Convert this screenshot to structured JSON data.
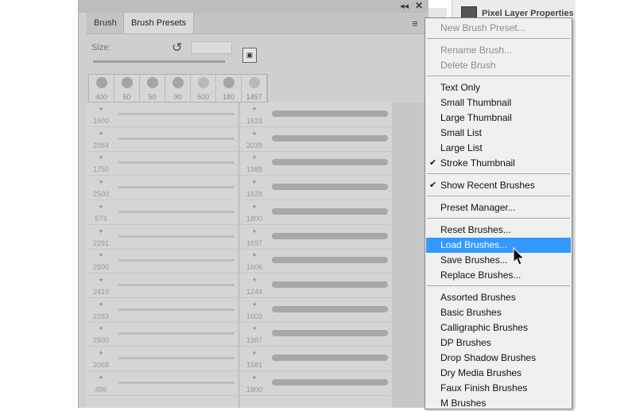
{
  "tabs": {
    "brush": "Brush",
    "presets": "Brush Presets"
  },
  "size_label": "Size:",
  "props_title": "Pixel Layer Properties",
  "recent_sizes": [
    "400",
    "50",
    "50",
    "90",
    "500",
    "180",
    "1457"
  ],
  "brushes_left": [
    "1600",
    "2084",
    "1750",
    "2500",
    "674",
    "2291",
    "2500",
    "2410",
    "2283",
    "2500",
    "2068",
    "496"
  ],
  "brushes_right": [
    "1623",
    "2039",
    "1988",
    "1628",
    "1800",
    "1697",
    "1606",
    "1244",
    "1603",
    "1987",
    "1581",
    "1800"
  ],
  "menu": {
    "new_preset": "New Brush Preset...",
    "rename": "Rename Brush...",
    "delete": "Delete Brush",
    "text_only": "Text Only",
    "small_thumb": "Small Thumbnail",
    "large_thumb": "Large Thumbnail",
    "small_list": "Small List",
    "large_list": "Large List",
    "stroke_thumb": "Stroke Thumbnail",
    "show_recent": "Show Recent Brushes",
    "preset_manager": "Preset Manager...",
    "reset": "Reset Brushes...",
    "load": "Load Brushes...",
    "save": "Save Brushes...",
    "replace": "Replace Brushes...",
    "assorted": "Assorted Brushes",
    "basic": "Basic Brushes",
    "calligraphic": "Calligraphic Brushes",
    "dp": "DP Brushes",
    "drop_shadow": "Drop Shadow Brushes",
    "dry_media": "Dry Media Brushes",
    "faux_finish": "Faux Finish Brushes",
    "m_brushes": "M Brushes"
  }
}
